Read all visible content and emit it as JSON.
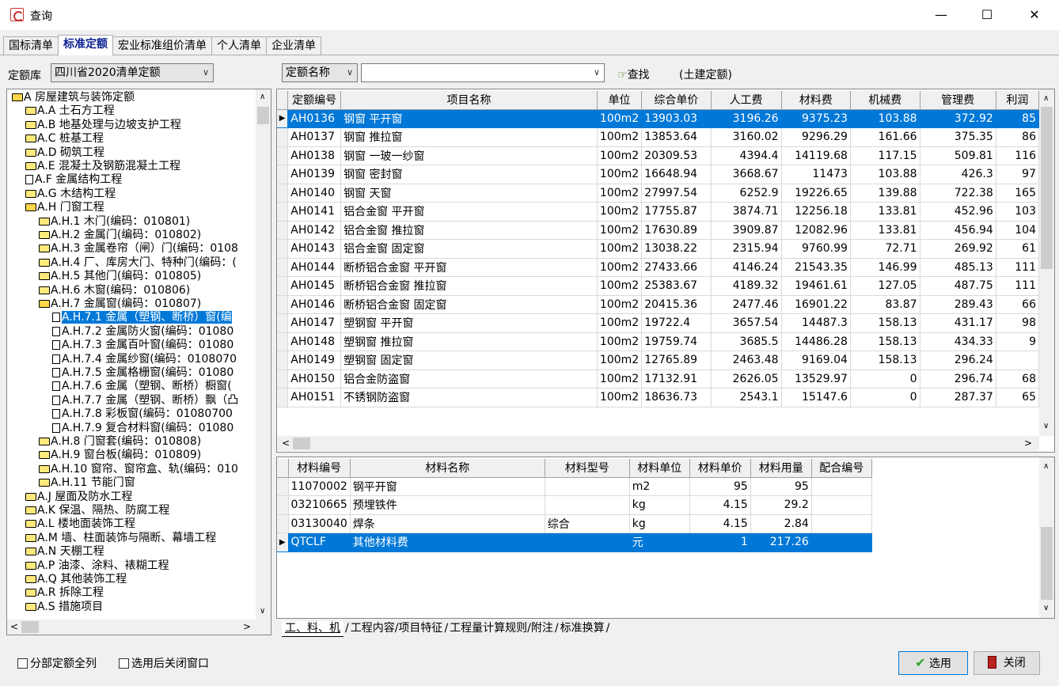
{
  "window": {
    "title": "查询",
    "min": "—",
    "max": "☐",
    "close": "✕"
  },
  "tabs": [
    "国标清单",
    "标准定额",
    "宏业标准组价清单",
    "个人清单",
    "企业清单"
  ],
  "toolbar": {
    "library_label": "定额库",
    "library_value": "四川省2020清单定额",
    "field_value": "定额名称",
    "search_value": "",
    "find_label": "查找",
    "scope_text": "(土建定额)"
  },
  "tree": [
    {
      "text": "A 房屋建筑与装饰定额",
      "icon": "open",
      "level": 0
    },
    {
      "text": "A.A 土石方工程",
      "icon": "folder",
      "level": 1
    },
    {
      "text": "A.B 地基处理与边坡支护工程",
      "icon": "folder",
      "level": 1
    },
    {
      "text": "A.C 桩基工程",
      "icon": "folder",
      "level": 1
    },
    {
      "text": "A.D 砌筑工程",
      "icon": "folder",
      "level": 1
    },
    {
      "text": "A.E 混凝土及钢筋混凝土工程",
      "icon": "folder",
      "level": 1
    },
    {
      "text": "A.F 金属结构工程",
      "icon": "doc",
      "level": 1
    },
    {
      "text": "A.G 木结构工程",
      "icon": "folder",
      "level": 1
    },
    {
      "text": "A.H 门窗工程",
      "icon": "open",
      "level": 1
    },
    {
      "text": "A.H.1 木门(编码：010801)",
      "icon": "folder",
      "level": 2
    },
    {
      "text": "A.H.2 金属门(编码：010802)",
      "icon": "folder",
      "level": 2
    },
    {
      "text": "A.H.3 金属卷帘（闸）门(编码：0108",
      "icon": "folder",
      "level": 2
    },
    {
      "text": "A.H.4 厂、库房大门、特种门(编码：(",
      "icon": "folder",
      "level": 2
    },
    {
      "text": "A.H.5 其他门(编码：010805)",
      "icon": "folder",
      "level": 2
    },
    {
      "text": "A.H.6 木窗(编码：010806)",
      "icon": "folder",
      "level": 2
    },
    {
      "text": "A.H.7 金属窗(编码：010807)",
      "icon": "open",
      "level": 2
    },
    {
      "text": "A.H.7.1 金属（塑钢、断桥）窗(编",
      "icon": "doc",
      "level": 3,
      "selected": true
    },
    {
      "text": "A.H.7.2 金属防火窗(编码：01080",
      "icon": "doc",
      "level": 3
    },
    {
      "text": "A.H.7.3 金属百叶窗(编码：01080",
      "icon": "doc",
      "level": 3
    },
    {
      "text": "A.H.7.4 金属纱窗(编码：0108070",
      "icon": "doc",
      "level": 3
    },
    {
      "text": "A.H.7.5 金属格栅窗(编码：01080",
      "icon": "doc",
      "level": 3
    },
    {
      "text": "A.H.7.6 金属（塑钢、断桥）橱窗(",
      "icon": "doc",
      "level": 3
    },
    {
      "text": "A.H.7.7 金属（塑钢、断桥）飘（凸",
      "icon": "doc",
      "level": 3
    },
    {
      "text": "A.H.7.8 彩板窗(编码：01080700",
      "icon": "doc",
      "level": 3
    },
    {
      "text": "A.H.7.9 复合材料窗(编码：01080",
      "icon": "doc",
      "level": 3
    },
    {
      "text": "A.H.8 门窗套(编码：010808)",
      "icon": "folder",
      "level": 2
    },
    {
      "text": "A.H.9 窗台板(编码：010809)",
      "icon": "folder",
      "level": 2
    },
    {
      "text": "A.H.10 窗帘、窗帘盒、轨(编码：010",
      "icon": "folder",
      "level": 2
    },
    {
      "text": "A.H.11 节能门窗",
      "icon": "folder",
      "level": 2
    },
    {
      "text": "A.J 屋面及防水工程",
      "icon": "folder",
      "level": 1
    },
    {
      "text": "A.K 保温、隔热、防腐工程",
      "icon": "folder",
      "level": 1
    },
    {
      "text": "A.L 楼地面装饰工程",
      "icon": "folder",
      "level": 1
    },
    {
      "text": "A.M 墙、柱面装饰与隔断、幕墙工程",
      "icon": "folder",
      "level": 1
    },
    {
      "text": "A.N 天棚工程",
      "icon": "folder",
      "level": 1
    },
    {
      "text": "A.P 油漆、涂料、裱糊工程",
      "icon": "folder",
      "level": 1
    },
    {
      "text": "A.Q 其他装饰工程",
      "icon": "folder",
      "level": 1
    },
    {
      "text": "A.R 拆除工程",
      "icon": "folder",
      "level": 1
    },
    {
      "text": "A.S 措施项目",
      "icon": "folder",
      "level": 1
    }
  ],
  "quota_table": {
    "columns": [
      "定额编号",
      "项目名称",
      "单位",
      "综合单价",
      "人工费",
      "材料费",
      "机械费",
      "管理费",
      "利润"
    ],
    "rows": [
      [
        "AH0136",
        "钢窗 平开窗",
        "100m2",
        "13903.03",
        "3196.26",
        "9375.23",
        "103.88",
        "372.92",
        "85"
      ],
      [
        "AH0137",
        "钢窗 推拉窗",
        "100m2",
        "13853.64",
        "3160.02",
        "9296.29",
        "161.66",
        "375.35",
        "86"
      ],
      [
        "AH0138",
        "钢窗 一玻一纱窗",
        "100m2",
        "20309.53",
        "4394.4",
        "14119.68",
        "117.15",
        "509.81",
        "116"
      ],
      [
        "AH0139",
        "钢窗 密封窗",
        "100m2",
        "16648.94",
        "3668.67",
        "11473",
        "103.88",
        "426.3",
        "97"
      ],
      [
        "AH0140",
        "钢窗 天窗",
        "100m2",
        "27997.54",
        "6252.9",
        "19226.65",
        "139.88",
        "722.38",
        "165"
      ],
      [
        "AH0141",
        "铝合金窗 平开窗",
        "100m2",
        "17755.87",
        "3874.71",
        "12256.18",
        "133.81",
        "452.96",
        "103"
      ],
      [
        "AH0142",
        "铝合金窗 推拉窗",
        "100m2",
        "17630.89",
        "3909.87",
        "12082.96",
        "133.81",
        "456.94",
        "104"
      ],
      [
        "AH0143",
        "铝合金窗 固定窗",
        "100m2",
        "13038.22",
        "2315.94",
        "9760.99",
        "72.71",
        "269.92",
        "61"
      ],
      [
        "AH0144",
        "断桥铝合金窗 平开窗",
        "100m2",
        "27433.66",
        "4146.24",
        "21543.35",
        "146.99",
        "485.13",
        "111"
      ],
      [
        "AH0145",
        "断桥铝合金窗 推拉窗",
        "100m2",
        "25383.67",
        "4189.32",
        "19461.61",
        "127.05",
        "487.75",
        "111"
      ],
      [
        "AH0146",
        "断桥铝合金窗 固定窗",
        "100m2",
        "20415.36",
        "2477.46",
        "16901.22",
        "83.87",
        "289.43",
        "66"
      ],
      [
        "AH0147",
        "塑钢窗 平开窗",
        "100m2",
        "19722.4",
        "3657.54",
        "14487.3",
        "158.13",
        "431.17",
        "98"
      ],
      [
        "AH0148",
        "塑钢窗 推拉窗",
        "100m2",
        "19759.74",
        "3685.5",
        "14486.28",
        "158.13",
        "434.33",
        "9"
      ],
      [
        "AH0149",
        "塑钢窗 固定窗",
        "100m2",
        "12765.89",
        "2463.48",
        "9169.04",
        "158.13",
        "296.24",
        ""
      ],
      [
        "AH0150",
        "铝合金防盗窗",
        "100m2",
        "17132.91",
        "2626.05",
        "13529.97",
        "0",
        "296.74",
        "68"
      ],
      [
        "AH0151",
        "不锈钢防盗窗",
        "100m2",
        "18636.73",
        "2543.1",
        "15147.6",
        "0",
        "287.37",
        "65"
      ]
    ]
  },
  "material_table": {
    "columns": [
      "材料编号",
      "材料名称",
      "材料型号",
      "材料单位",
      "材料单价",
      "材料用量",
      "配合编号"
    ],
    "rows": [
      [
        "11070002",
        "钢平开窗",
        "",
        "m2",
        "95",
        "95",
        ""
      ],
      [
        "03210665",
        "预埋铁件",
        "",
        "kg",
        "4.15",
        "29.2",
        ""
      ],
      [
        "03130040",
        "焊条",
        "综合",
        "kg",
        "4.15",
        "2.84",
        ""
      ],
      [
        "QTCLF",
        "其他材料费",
        "",
        "元",
        "1",
        "217.26",
        ""
      ]
    ]
  },
  "bottom_tabs": [
    "工、料、机",
    "工程内容/项目特征",
    "工程量计算规则/附注",
    "标准换算"
  ],
  "footer": {
    "check_all": "分部定额全列",
    "check_close": "选用后关闭窗口",
    "select_btn": "选用",
    "close_btn": "关闭"
  },
  "colors": {
    "selection": "#0078d7",
    "active_tab_text": "#0a1f8f"
  }
}
